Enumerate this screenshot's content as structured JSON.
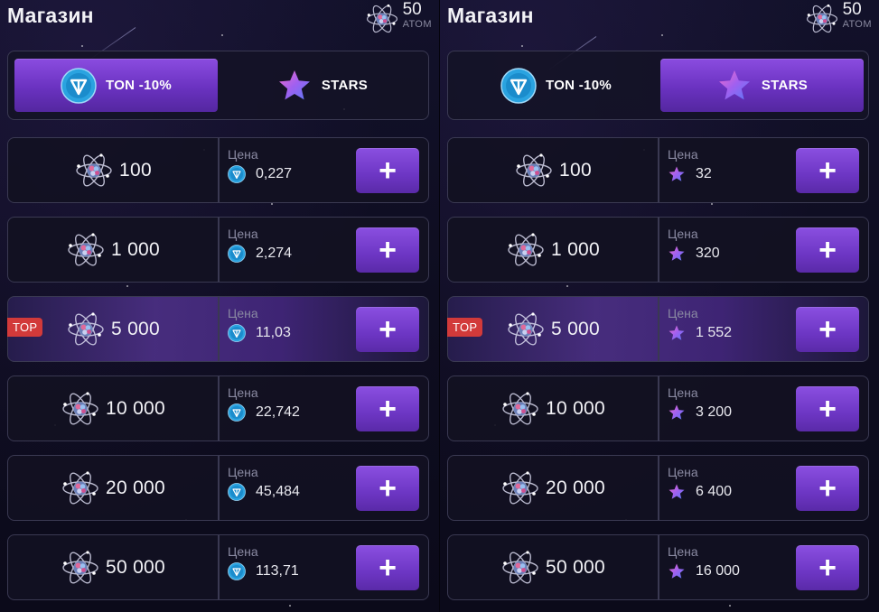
{
  "panels": [
    {
      "title": "Магазин",
      "balance": {
        "value": "50",
        "unit": "АТОМ"
      },
      "tabs": [
        {
          "label": "TON -10%",
          "icon": "ton-icon",
          "active": true
        },
        {
          "label": "STARS",
          "icon": "star-icon",
          "active": false
        }
      ],
      "price_label": "Цена",
      "currency_icon": "ton-icon",
      "items": [
        {
          "amount": "100",
          "price": "0,227",
          "badge": ""
        },
        {
          "amount": "1 000",
          "price": "2,274",
          "badge": ""
        },
        {
          "amount": "5 000",
          "price": "11,03",
          "badge": "TOP"
        },
        {
          "amount": "10 000",
          "price": "22,742",
          "badge": ""
        },
        {
          "amount": "20 000",
          "price": "45,484",
          "badge": ""
        },
        {
          "amount": "50 000",
          "price": "113,71",
          "badge": ""
        }
      ],
      "buy_label": "+"
    },
    {
      "title": "Магазин",
      "balance": {
        "value": "50",
        "unit": "АТОМ"
      },
      "tabs": [
        {
          "label": "TON -10%",
          "icon": "ton-icon",
          "active": false
        },
        {
          "label": "STARS",
          "icon": "star-icon",
          "active": true
        }
      ],
      "price_label": "Цена",
      "currency_icon": "star-icon",
      "items": [
        {
          "amount": "100",
          "price": "32",
          "badge": ""
        },
        {
          "amount": "1 000",
          "price": "320",
          "badge": ""
        },
        {
          "amount": "5 000",
          "price": "1 552",
          "badge": "TOP"
        },
        {
          "amount": "10 000",
          "price": "3 200",
          "badge": ""
        },
        {
          "amount": "20 000",
          "price": "6 400",
          "badge": ""
        },
        {
          "amount": "50 000",
          "price": "16 000",
          "badge": ""
        }
      ],
      "buy_label": "+"
    }
  ],
  "colors": {
    "accent": "#7a42d6",
    "badge": "#d23a3a",
    "ton": "#2aa3e0",
    "star": "#c255e8"
  }
}
